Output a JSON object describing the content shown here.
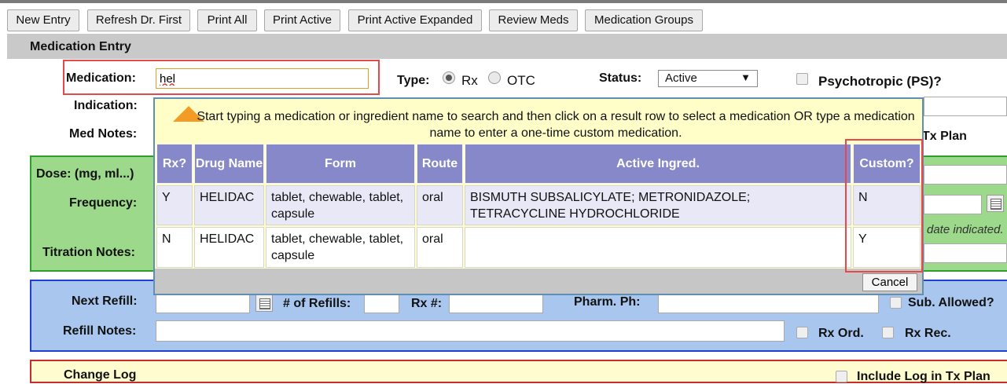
{
  "toolbar": {
    "buttons": [
      "New Entry",
      "Refresh Dr. First",
      "Print All",
      "Print Active",
      "Print Active Expanded",
      "Review Meds",
      "Medication Groups"
    ]
  },
  "section": {
    "title": "Medication Entry"
  },
  "form": {
    "medication_label": "Medication:",
    "medication_value": "hel",
    "type_label": "Type:",
    "type_rx": "Rx",
    "type_otc": "OTC",
    "status_label": "Status:",
    "status_value": "Active",
    "psychotropic_label": "Psychotropic (PS)?",
    "indication_label": "Indication:",
    "med_notes_label": "Med Notes:",
    "tx_plan_label": "Tx Plan"
  },
  "dose": {
    "dose_label": "Dose: (mg, ml...)",
    "frequency_label": "Frequency:",
    "titration_label": "Titration Notes:",
    "date_note": "date indicated."
  },
  "refill": {
    "next_refill_label": "Next Refill:",
    "num_refills_label": "# of Refills:",
    "rx_num_label": "Rx #:",
    "pharm_ph_label": "Pharm. Ph:",
    "sub_allowed_label": "Sub. Allowed?",
    "refill_notes_label": "Refill Notes:",
    "rx_ord_label": "Rx Ord.",
    "rx_rec_label": "Rx Rec."
  },
  "change_log": {
    "title": "Change Log",
    "include_label": "Include Log in Tx Plan"
  },
  "popup": {
    "message": "Start typing a medication or ingredient name to search and then click on a result row to select a medication OR type a medication name to enter a one-time custom medication.",
    "headers": [
      "Rx?",
      "Drug Name",
      "Form",
      "Route",
      "Active Ingred.",
      "Custom?"
    ],
    "rows": [
      {
        "rx": "Y",
        "drug": "HELIDAC",
        "form": "tablet, chewable, tablet, capsule",
        "route": "oral",
        "ingred": "BISMUTH SUBSALICYLATE; METRONIDAZOLE; TETRACYCLINE HYDROCHLORIDE",
        "custom": "N"
      },
      {
        "rx": "N",
        "drug": "HELIDAC",
        "form": "tablet, chewable, tablet, capsule",
        "route": "oral",
        "ingred": "",
        "custom": "Y"
      }
    ],
    "cancel_label": "Cancel"
  },
  "colors": {
    "header_bg": "#8788c9",
    "popup_bg": "#fffec8",
    "highlight": "#e8484a",
    "dose_bg": "#9dd98a",
    "refill_bg": "#a9c7ee"
  }
}
